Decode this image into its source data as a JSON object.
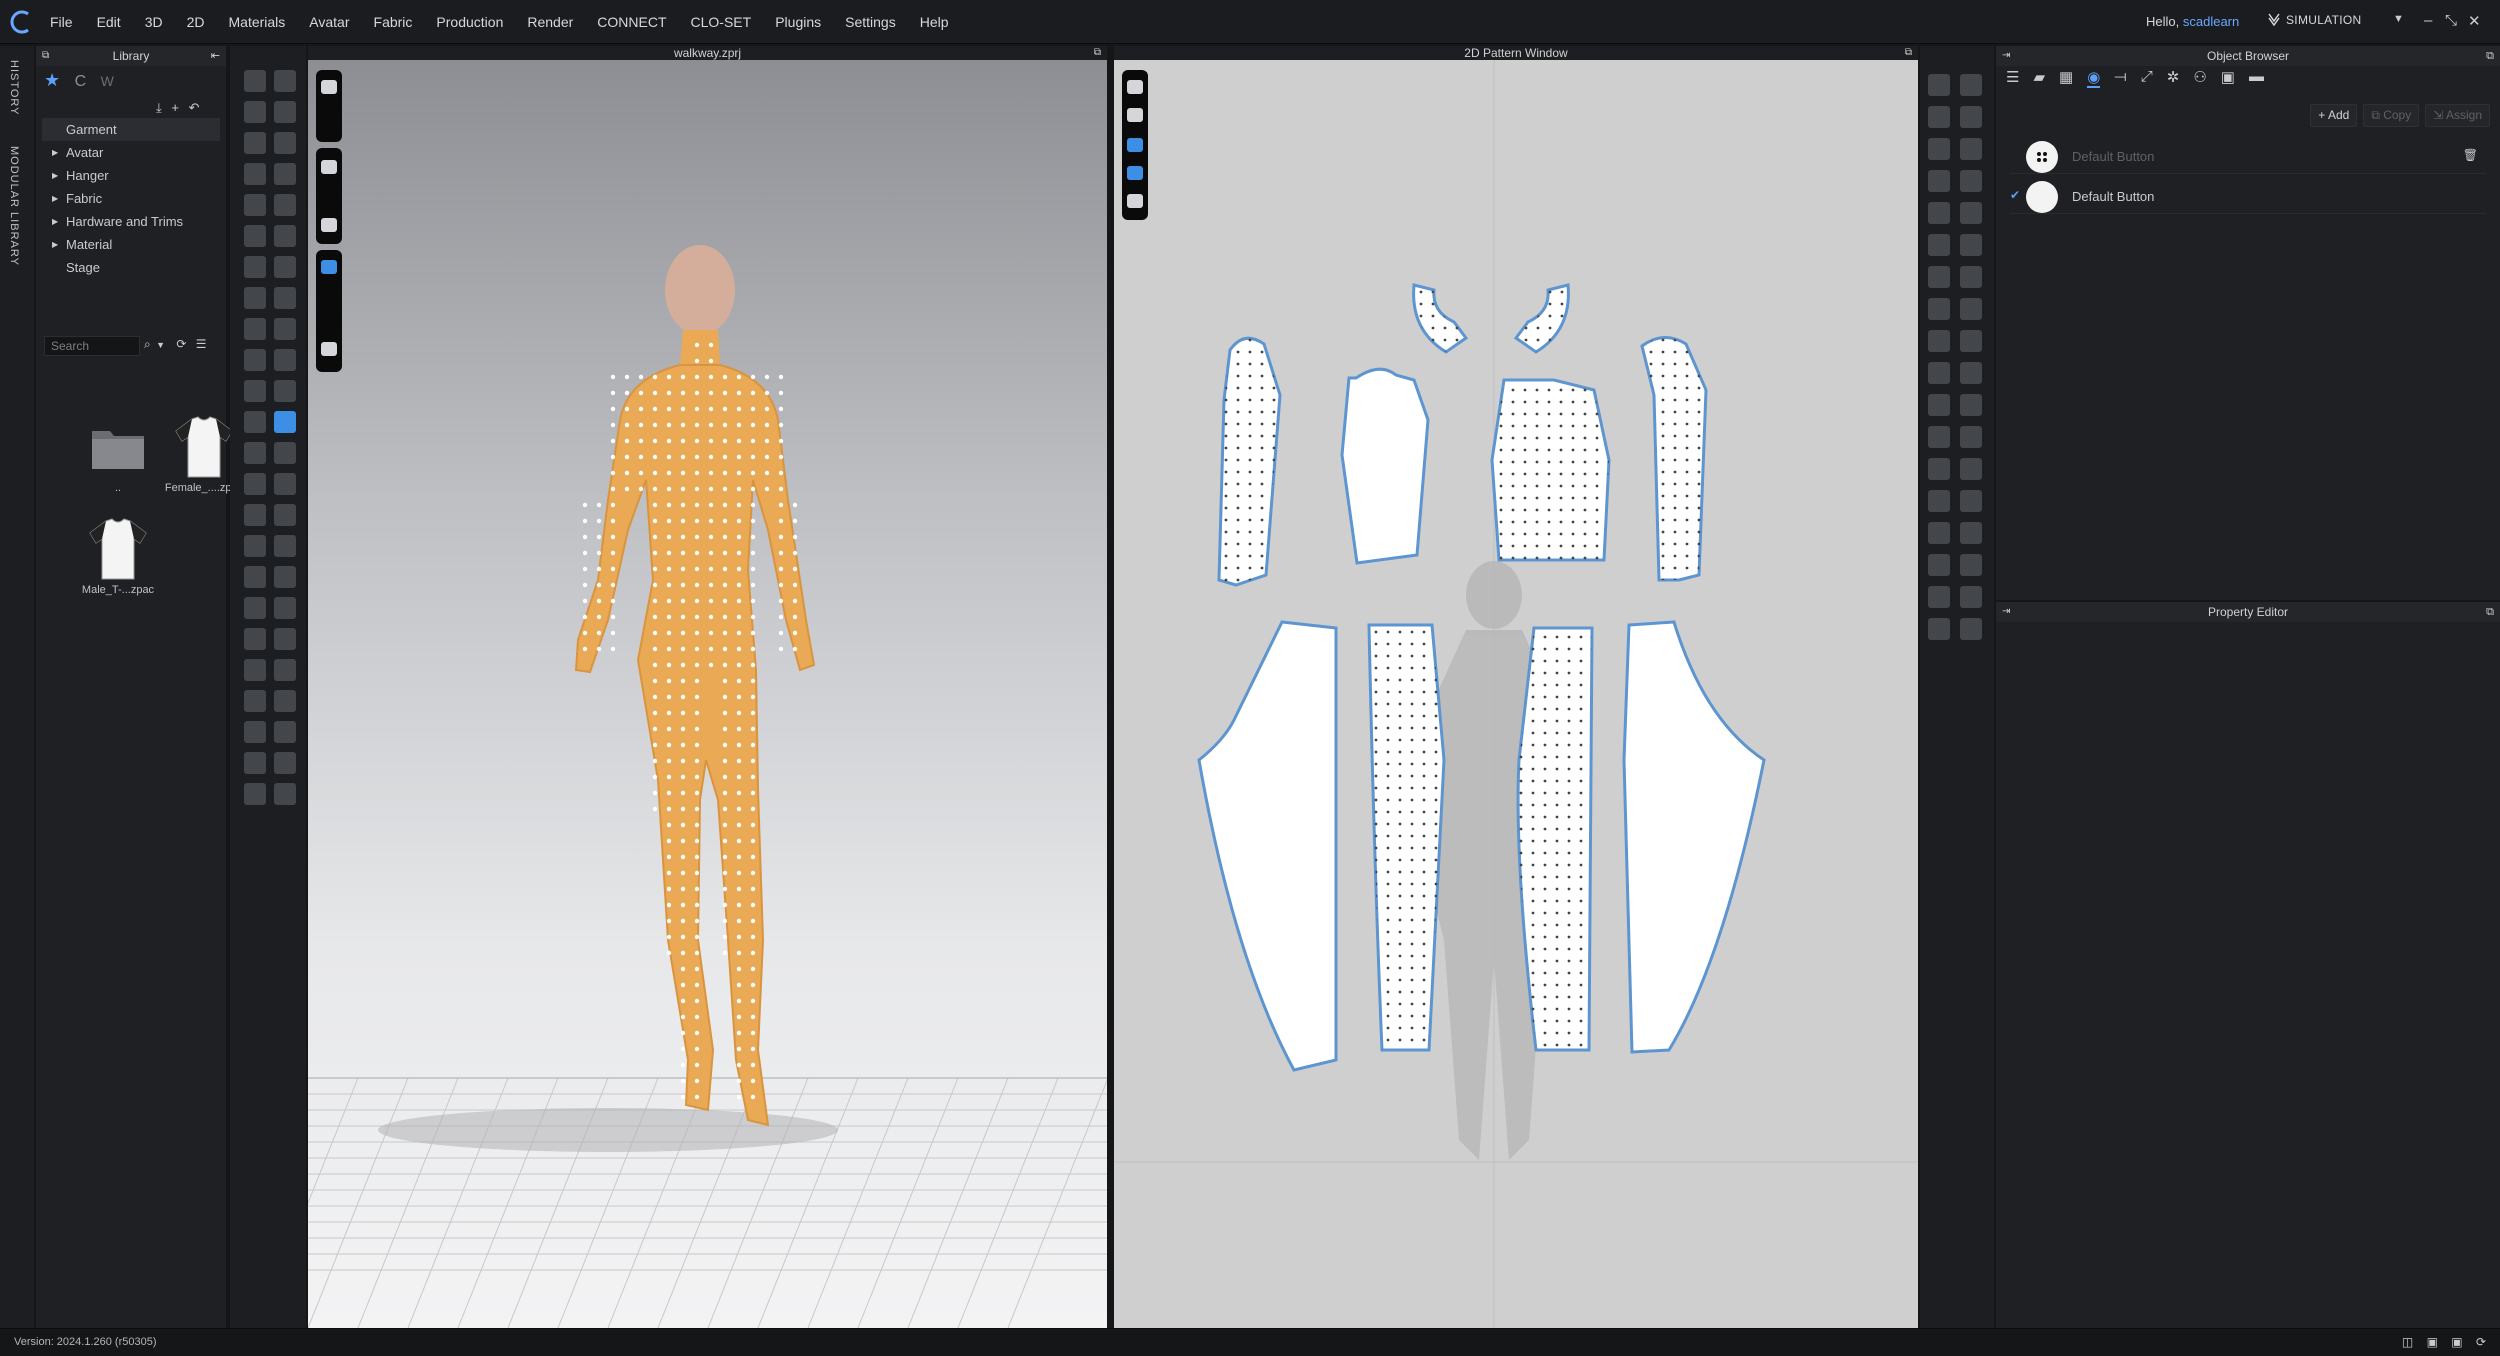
{
  "menubar": {
    "items": [
      "File",
      "Edit",
      "3D",
      "2D",
      "Materials",
      "Avatar",
      "Fabric",
      "Production",
      "Render",
      "CONNECT",
      "CLO-SET",
      "Plugins",
      "Settings",
      "Help"
    ],
    "greeting_prefix": "Hello, ",
    "username": "scadlearn",
    "mode_label": "SIMULATION"
  },
  "left_tabs": {
    "history": "HISTORY",
    "modular_library": "MODULAR LIBRARY"
  },
  "library": {
    "title": "Library",
    "tree": [
      {
        "label": "Garment",
        "selected": true,
        "expandable": false
      },
      {
        "label": "Avatar",
        "selected": false,
        "expandable": true
      },
      {
        "label": "Hanger",
        "selected": false,
        "expandable": true
      },
      {
        "label": "Fabric",
        "selected": false,
        "expandable": true
      },
      {
        "label": "Hardware and Trims",
        "selected": false,
        "expandable": true
      },
      {
        "label": "Material",
        "selected": false,
        "expandable": true
      },
      {
        "label": "Stage",
        "selected": false,
        "expandable": false
      }
    ],
    "search_placeholder": "Search",
    "files": [
      {
        "label": "..",
        "icon": "folder-icon"
      },
      {
        "label": "Female_....zpac",
        "icon": "tshirt-icon"
      },
      {
        "label": "Male_T-...zpac",
        "icon": "tshirt-icon"
      }
    ]
  },
  "viewport3d": {
    "title": "walkway.zprj"
  },
  "viewport2d": {
    "title": "2D Pattern Window"
  },
  "object_browser": {
    "title": "Object Browser",
    "add_label": "Add",
    "copy_label": "Copy",
    "assign_label": "Assign",
    "items": [
      {
        "label": "Default Button",
        "active": false
      },
      {
        "label": "Default Button",
        "active": true
      }
    ]
  },
  "property_editor": {
    "title": "Property Editor"
  },
  "status": {
    "version": "Version: 2024.1.260 (r50305)"
  },
  "colors": {
    "accent": "#3d8fe6",
    "avatar_suit": "#e9a955",
    "pattern_outline": "#5d95d0"
  }
}
